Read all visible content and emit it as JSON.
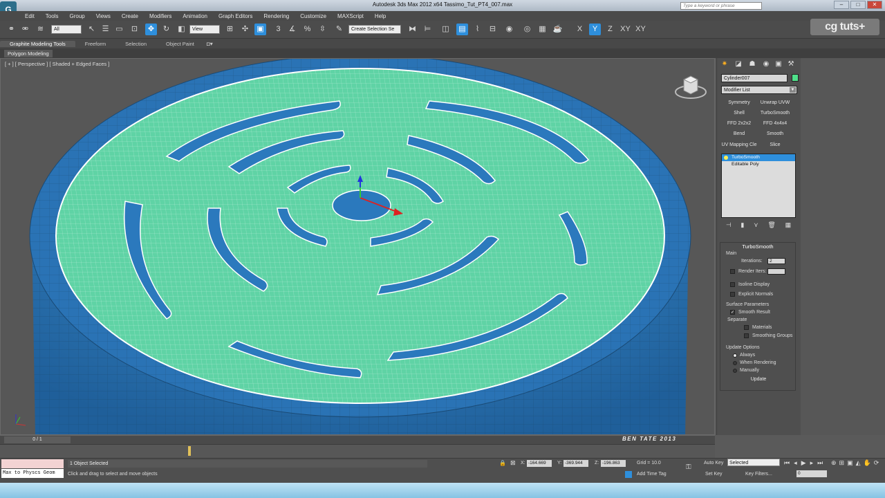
{
  "window": {
    "title": "Autodesk 3ds Max  2012 x64     Tassimo_Tut_PT4_007.max",
    "search_placeholder": "Type a keyword or phrase"
  },
  "menu": [
    "Edit",
    "Tools",
    "Group",
    "Views",
    "Create",
    "Modifiers",
    "Animation",
    "Graph Editors",
    "Rendering",
    "Customize",
    "MAXScript",
    "Help"
  ],
  "toolbar": {
    "filter": "All",
    "view_dropdown": "View",
    "named_selection": "Create Selection Se",
    "axis": [
      "X",
      "Y",
      "Z",
      "XY",
      "XY"
    ]
  },
  "logo_text": "cg tuts+",
  "ribbon": {
    "tabs": [
      "Graphite Modeling Tools",
      "Freeform",
      "Selection",
      "Object Paint"
    ],
    "sub_tab": "Polygon Modeling"
  },
  "viewport": {
    "label": "[ + ] [ Perspective ] [ Shaded + Edged Faces ]"
  },
  "command_panel": {
    "object_name": "Cylinder007",
    "object_color": "#4fe08a",
    "modifier_list": "Modifier List",
    "modifier_buttons": [
      "Symmetry",
      "Unwrap UVW",
      "Shell",
      "TurboSmooth",
      "FFD 2x2x2",
      "FFD 4x4x4",
      "Bend",
      "Smooth",
      "UV Mapping Cle",
      "Slice"
    ],
    "stack": [
      {
        "label": "TurboSmooth"
      },
      {
        "label": "Editable Poly"
      }
    ],
    "rollout": {
      "title": "TurboSmooth",
      "main_label": "Main",
      "iterations_label": "Iterations:",
      "iterations_value": "2",
      "render_iters_label": "Render Iters:",
      "render_iters_value": "",
      "isoline_label": "Isoline Display",
      "explicit_label": "Explicit Normals",
      "surface_label": "Surface Parameters",
      "smooth_result_label": "Smooth Result",
      "separate_label": "Separate",
      "materials_label": "Materials",
      "smoothing_groups_label": "Smoothing Groups",
      "update_options_label": "Update Options",
      "always_label": "Always",
      "when_rendering_label": "When Rendering",
      "manually_label": "Manually",
      "update_button": "Update"
    }
  },
  "timeline": {
    "position": "0 / 1",
    "credit": "BEN TATE 2013"
  },
  "status": {
    "maxscript_text": "Max to Physcs Geom",
    "selection": "1 Object Selected",
    "prompt": "Click and drag to select and move objects",
    "x_label": "X:",
    "x_value": "-164.669",
    "y_label": "Y:",
    "y_value": "-369.944",
    "z_label": "Z:",
    "z_value": "-196.863",
    "grid": "Grid = 10.0",
    "add_time_tag": "Add Time Tag",
    "auto_key": "Auto Key",
    "set_key": "Set Key",
    "key_mode": "Selected",
    "key_filters": "Key Filters...",
    "frame": "0"
  }
}
